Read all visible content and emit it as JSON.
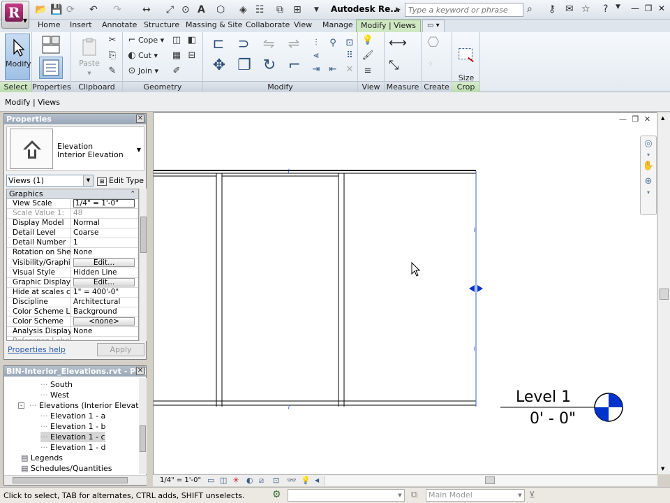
{
  "app": {
    "title": "Autodesk Re...",
    "search_placeholder": "Type a keyword or phrase",
    "app_letter": "R"
  },
  "ribbon_tabs": [
    {
      "label": "Home"
    },
    {
      "label": "Insert"
    },
    {
      "label": "Annotate"
    },
    {
      "label": "Structure"
    },
    {
      "label": "Massing & Site"
    },
    {
      "label": "Collaborate"
    },
    {
      "label": "View"
    },
    {
      "label": "Manage"
    },
    {
      "label": "Modify | Views"
    }
  ],
  "ribbon": {
    "select": {
      "label": "Select",
      "modify_button": "Modify"
    },
    "properties": {
      "label": "Properties"
    },
    "clipboard": {
      "label": "Clipboard",
      "paste": "Paste"
    },
    "geometry": {
      "label": "Geometry",
      "cope": "Cope",
      "cut": "Cut",
      "join": "Join"
    },
    "modify": {
      "label": "Modify"
    },
    "view": {
      "label": "View"
    },
    "measure": {
      "label": "Measure"
    },
    "create": {
      "label": "Create"
    },
    "crop": {
      "label": "Crop",
      "size_crop": "Size\nCrop"
    }
  },
  "options_bar": {
    "context": "Modify | Views"
  },
  "properties": {
    "title": "Properties",
    "type_name_line1": "Elevation",
    "type_name_line2": "Interior Elevation",
    "instance_filter": "Views (1)",
    "edit_type": "Edit Type",
    "group": "Graphics",
    "rows": [
      {
        "key": "View Scale",
        "value": "1/4\" = 1'-0\"",
        "kind": "input"
      },
      {
        "key": "Scale Value    1:",
        "value": "48",
        "kind": "disabled"
      },
      {
        "key": "Display Model",
        "value": "Normal",
        "kind": "text"
      },
      {
        "key": "Detail Level",
        "value": "Coarse",
        "kind": "text"
      },
      {
        "key": "Detail Number",
        "value": "1",
        "kind": "text"
      },
      {
        "key": "Rotation on Sheet",
        "value": "None",
        "kind": "text"
      },
      {
        "key": "Visibility/Graphic...",
        "value": "Edit...",
        "kind": "button"
      },
      {
        "key": "Visual Style",
        "value": "Hidden Line",
        "kind": "text"
      },
      {
        "key": "Graphic Display ...",
        "value": "Edit...",
        "kind": "button"
      },
      {
        "key": "Hide at scales c...",
        "value": "1\" = 400'-0\"",
        "kind": "text"
      },
      {
        "key": "Discipline",
        "value": "Architectural",
        "kind": "text"
      },
      {
        "key": "Color Scheme L...",
        "value": "Background",
        "kind": "text"
      },
      {
        "key": "Color Scheme",
        "value": "<none>",
        "kind": "button"
      },
      {
        "key": "Analysis Display...",
        "value": "None",
        "kind": "text"
      },
      {
        "key": "Reference Label",
        "value": "",
        "kind": "disabled"
      }
    ],
    "help_link": "Properties help",
    "apply": "Apply"
  },
  "browser": {
    "title": "BIN-Interior_Elevations.rvt - Proje...",
    "items": [
      {
        "label": "South",
        "indent": 3
      },
      {
        "label": "West",
        "indent": 3
      },
      {
        "label": "Elevations (Interior Elevation",
        "indent": 2,
        "expander": "-"
      },
      {
        "label": "Elevation 1 - a",
        "indent": 3
      },
      {
        "label": "Elevation 1 - b",
        "indent": 3
      },
      {
        "label": "Elevation 1 - c",
        "indent": 3,
        "selected": true
      },
      {
        "label": "Elevation 1 - d",
        "indent": 3
      },
      {
        "label": "Legends",
        "indent": 1,
        "icon": true
      },
      {
        "label": "Schedules/Quantities",
        "indent": 1,
        "icon": true
      }
    ]
  },
  "drawing": {
    "level_name": "Level 1",
    "level_elevation": "0' - 0\""
  },
  "view_control": {
    "scale": "1/4\" = 1'-0\""
  },
  "status": {
    "message": "Click to select, TAB for alternates, CTRL adds, SHIFT unselects.",
    "model": "Main Model"
  },
  "colors": {
    "accent_blue": "#0033cc",
    "crop_region": "#3a5fcd"
  }
}
